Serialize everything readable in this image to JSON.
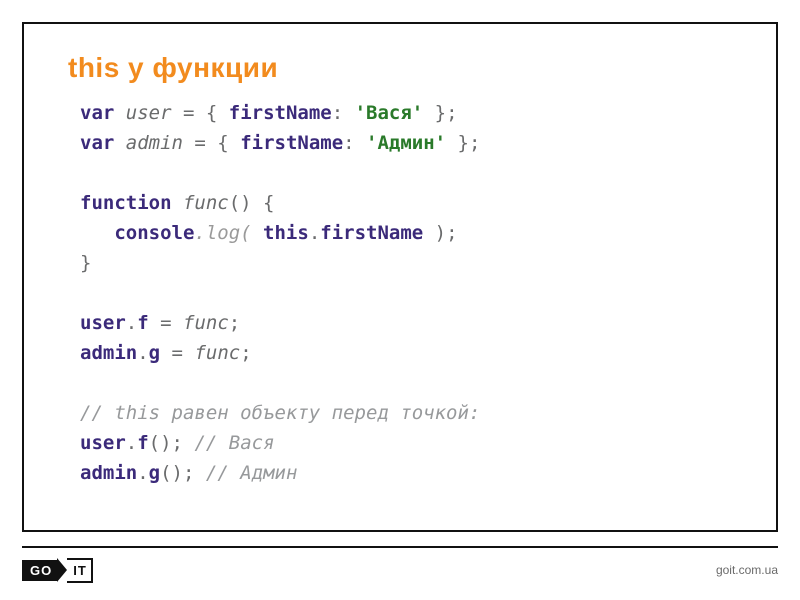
{
  "title": "this у функции",
  "code": {
    "l1": {
      "var": "var",
      "user": "user",
      "eq": " = { ",
      "fn": "firstName",
      "col": ": ",
      "str": "'Вася'",
      "end": " };"
    },
    "l2": {
      "var": "var",
      "admin": "admin",
      "eq": " = { ",
      "fn": "firstName",
      "col": ": ",
      "str": "'Админ'",
      "end": " };"
    },
    "l4": {
      "function": "function",
      "func": "func",
      "paren": "() {"
    },
    "l5": {
      "console": "console",
      "dotlog": ".log( ",
      "this": "this",
      "dot": ".",
      "fn": "firstName",
      "close": " );"
    },
    "l6": {
      "brace": "}"
    },
    "l8": {
      "user": "user",
      "dot": ".",
      "f": "f",
      "eq": " = ",
      "func": "func",
      "semi": ";"
    },
    "l9": {
      "admin": "admin",
      "dot": ".",
      "g": "g",
      "eq": " = ",
      "func": "func",
      "semi": ";"
    },
    "l11": {
      "cmt": "// this равен объекту перед точкой:"
    },
    "l12": {
      "user": "user",
      "dot": ".",
      "f": "f",
      "paren": "();",
      "cmt": " // Вася"
    },
    "l13": {
      "admin": "admin",
      "dot": ".",
      "g": "g",
      "paren": "();",
      "cmt": " // Админ"
    }
  },
  "footer": {
    "logo_go": "GO",
    "logo_it": "IT",
    "link": "goit.com.ua"
  }
}
